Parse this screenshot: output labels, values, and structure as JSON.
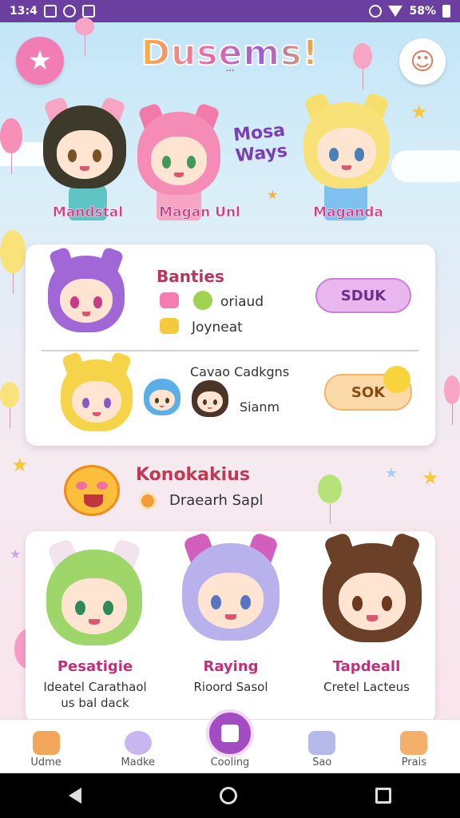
{
  "status_bar": {
    "time": "13:4",
    "battery": "58%"
  },
  "app": {
    "logo": "Dusems!",
    "logo_sub": "..."
  },
  "top_characters": [
    {
      "name": "Mandstal"
    },
    {
      "name": "Magan Unl"
    },
    {
      "name": "Maganda"
    }
  ],
  "side_text": "Mosa Ways",
  "card1": {
    "title": "Banties",
    "line1": "oriaud",
    "line2": "Joyneat",
    "button1": "SDUK",
    "row2_title": "Cavao Cadkgns",
    "row2_sub": "Sianm",
    "button2": "SOK"
  },
  "konok": {
    "title": "Konokakius",
    "sub": "Draearh Sapl"
  },
  "card2": {
    "items": [
      {
        "name": "Pesatigie",
        "desc": "Ideatel Carathaol us bal dack"
      },
      {
        "name": "Raying",
        "desc": "Rioord Sasol"
      },
      {
        "name": "Tapdeall",
        "desc": "Cretel Lacteus"
      }
    ]
  },
  "nav": {
    "items": [
      {
        "label": "Udme"
      },
      {
        "label": "Madke"
      },
      {
        "label": "Cooling"
      },
      {
        "label": "Sao"
      },
      {
        "label": "Prais"
      }
    ]
  },
  "colors": {
    "status": "#6b3fa0",
    "accent": "#a24cc4",
    "pink": "#f17db4"
  }
}
